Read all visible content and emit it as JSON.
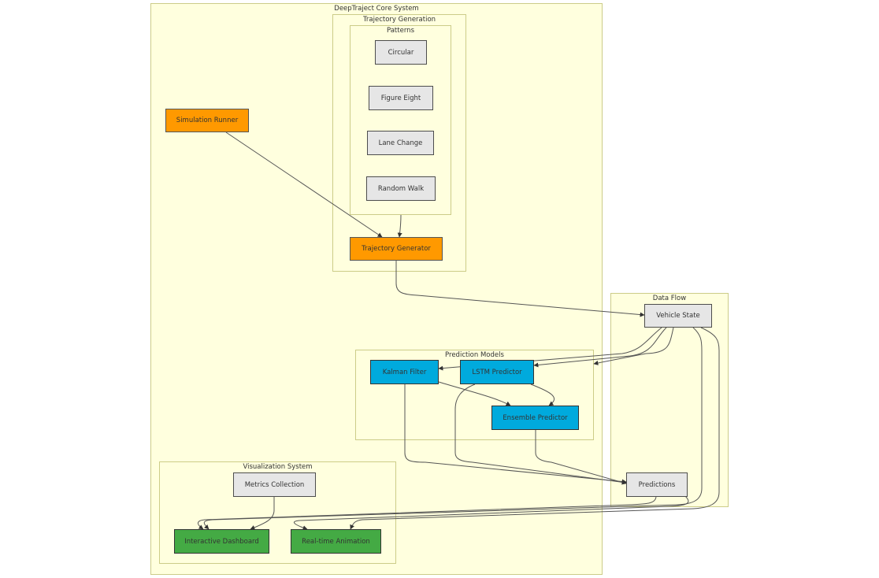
{
  "clusters": {
    "core": "DeepTraject Core System",
    "trajectory_generation": "Trajectory Generation",
    "patterns": "Patterns",
    "data_flow": "Data Flow",
    "prediction_models": "Prediction Models",
    "visualization": "Visualization System"
  },
  "nodes": {
    "circular": "Circular",
    "figure_eight": "Figure Eight",
    "lane_change": "Lane Change",
    "random_walk": "Random Walk",
    "simulation_runner": "Simulation Runner",
    "trajectory_generator": "Trajectory Generator",
    "vehicle_state": "Vehicle State",
    "kalman_filter": "Kalman Filter",
    "lstm_predictor": "LSTM Predictor",
    "ensemble_predictor": "Ensemble Predictor",
    "predictions": "Predictions",
    "metrics_collection": "Metrics Collection",
    "interactive_dashboard": "Interactive Dashboard",
    "realtime_animation": "Real-time Animation"
  },
  "colors": {
    "cluster_fill": "#ffffde",
    "cluster_border": "#cccc88",
    "default_node": "#e6e6e6",
    "simulation": "#ff9900",
    "prediction": "#00aadd",
    "visualization": "#44aa44"
  },
  "edges": [
    {
      "from": "Simulation Runner",
      "to": "Trajectory Generator"
    },
    {
      "from": "Patterns",
      "to": "Trajectory Generator"
    },
    {
      "from": "Trajectory Generator",
      "to": "Vehicle State"
    },
    {
      "from": "Vehicle State",
      "to": "Kalman Filter"
    },
    {
      "from": "Vehicle State",
      "to": "LSTM Predictor"
    },
    {
      "from": "Vehicle State",
      "to": "Prediction Models"
    },
    {
      "from": "Kalman Filter",
      "to": "Ensemble Predictor"
    },
    {
      "from": "LSTM Predictor",
      "to": "Ensemble Predictor"
    },
    {
      "from": "Kalman Filter",
      "to": "Predictions"
    },
    {
      "from": "LSTM Predictor",
      "to": "Predictions"
    },
    {
      "from": "Ensemble Predictor",
      "to": "Predictions"
    },
    {
      "from": "Vehicle State",
      "to": "Interactive Dashboard"
    },
    {
      "from": "Vehicle State",
      "to": "Real-time Animation"
    },
    {
      "from": "Predictions",
      "to": "Interactive Dashboard"
    },
    {
      "from": "Predictions",
      "to": "Real-time Animation"
    },
    {
      "from": "Metrics Collection",
      "to": "Interactive Dashboard"
    }
  ]
}
